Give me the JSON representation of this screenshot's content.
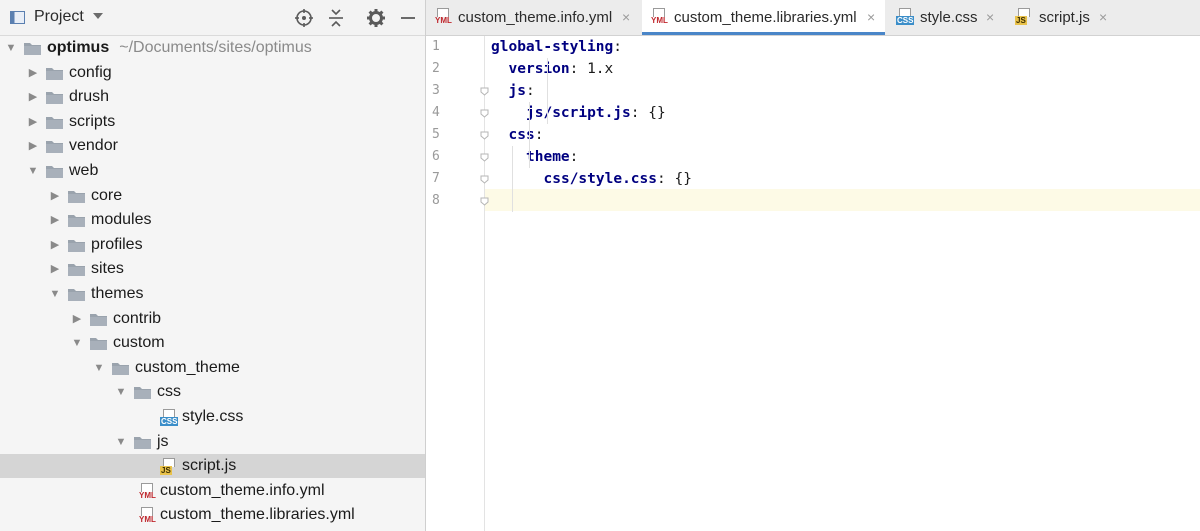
{
  "project_panel": {
    "title": "Project",
    "tree": [
      {
        "label": "optimus",
        "path": "~/Documents/sites/optimus",
        "type": "root",
        "expanded": true,
        "depth": 0
      },
      {
        "label": "config",
        "type": "folder",
        "expanded": false,
        "depth": 1
      },
      {
        "label": "drush",
        "type": "folder",
        "expanded": false,
        "depth": 1
      },
      {
        "label": "scripts",
        "type": "folder",
        "expanded": false,
        "depth": 1
      },
      {
        "label": "vendor",
        "type": "folder",
        "expanded": false,
        "depth": 1
      },
      {
        "label": "web",
        "type": "folder",
        "expanded": true,
        "depth": 1
      },
      {
        "label": "core",
        "type": "folder",
        "expanded": false,
        "depth": 2
      },
      {
        "label": "modules",
        "type": "folder",
        "expanded": false,
        "depth": 2
      },
      {
        "label": "profiles",
        "type": "folder",
        "expanded": false,
        "depth": 2
      },
      {
        "label": "sites",
        "type": "folder",
        "expanded": false,
        "depth": 2
      },
      {
        "label": "themes",
        "type": "folder",
        "expanded": true,
        "depth": 2
      },
      {
        "label": "contrib",
        "type": "folder",
        "expanded": false,
        "depth": 3
      },
      {
        "label": "custom",
        "type": "folder",
        "expanded": true,
        "depth": 3
      },
      {
        "label": "custom_theme",
        "type": "folder",
        "expanded": true,
        "depth": 4
      },
      {
        "label": "css",
        "type": "folder",
        "expanded": true,
        "depth": 5
      },
      {
        "label": "style.css",
        "type": "file",
        "icon": "CSS",
        "depth": 6
      },
      {
        "label": "js",
        "type": "folder",
        "expanded": true,
        "depth": 5
      },
      {
        "label": "script.js",
        "type": "file",
        "icon": "JS",
        "depth": 6,
        "selected": true
      },
      {
        "label": "custom_theme.info.yml",
        "type": "file",
        "icon": "YML",
        "depth": 5
      },
      {
        "label": "custom_theme.libraries.yml",
        "type": "file",
        "icon": "YML",
        "depth": 5
      }
    ]
  },
  "editor": {
    "tabs": [
      {
        "label": "custom_theme.info.yml",
        "icon": "YML",
        "active": false,
        "close": "×"
      },
      {
        "label": "custom_theme.libraries.yml",
        "icon": "YML",
        "active": true,
        "close": "×"
      },
      {
        "label": "style.css",
        "icon": "CSS",
        "active": false,
        "close": "×"
      },
      {
        "label": "script.js",
        "icon": "JS",
        "active": false,
        "close": "×"
      }
    ],
    "line_numbers": [
      "1",
      "2",
      "3",
      "4",
      "5",
      "6",
      "7",
      "8"
    ],
    "code_lines": [
      {
        "key": "global-styling",
        "colon": ":",
        "value": ""
      },
      {
        "key": "version",
        "colon": ":",
        "value": " 1.x"
      },
      {
        "key": "js",
        "colon": ":",
        "value": ""
      },
      {
        "key": "js/script.js",
        "colon": ":",
        "value": " {}"
      },
      {
        "key": "css",
        "colon": ":",
        "value": ""
      },
      {
        "key": "theme",
        "colon": ":",
        "value": ""
      },
      {
        "key": "css/style.css",
        "colon": ":",
        "value": " {}"
      },
      {
        "key": "",
        "colon": "",
        "value": ""
      }
    ],
    "current_line": 8
  },
  "colors": {
    "key": "#000080",
    "selection": "#d5d5d5",
    "active_tab_underline": "#4a86c8",
    "current_line_bg": "#fdfae6",
    "css_badge": "#3b8ec9",
    "js_badge": "#e9c24a",
    "yml_badge": "#c0272d"
  },
  "icons": {
    "panel": "project-panel-icon",
    "locate": "crosshair-icon",
    "collapse": "collapse-all-icon",
    "settings": "gear-icon",
    "hide": "minimize-icon",
    "folder": "folder-icon",
    "expanded": "triangle-down-icon",
    "collapsed": "triangle-right-icon"
  }
}
